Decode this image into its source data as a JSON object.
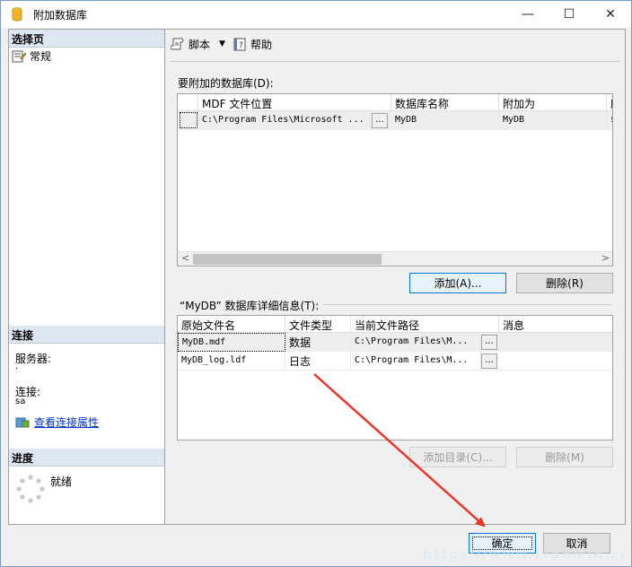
{
  "window": {
    "title": "附加数据库",
    "minimize": "—",
    "maximize": "☐",
    "close": "✕"
  },
  "left": {
    "select_page_header": "选择页",
    "pages": [
      {
        "label": "常规",
        "icon": "page-icon"
      }
    ],
    "connection_header": "连接",
    "server_label": "服务器:",
    "server_value": ".",
    "connection_label": "连接:",
    "connection_value": "sa",
    "view_properties_link": "查看连接属性",
    "progress_header": "进度",
    "progress_status": "就绪"
  },
  "toolbar": {
    "script_label": "脚本",
    "script_dropdown": "▼",
    "help_label": "帮助"
  },
  "attach_grid": {
    "label": "要附加的数据库(D):",
    "columns": [
      "MDF 文件位置",
      "数据库名称",
      "附加为",
      "所"
    ],
    "rows": [
      {
        "mdf": "C:\\Program Files\\Microsoft ...",
        "ellipsis": "...",
        "dbname": "MyDB",
        "attach_as": "MyDB",
        "owner": "s"
      }
    ],
    "scroll_left": "<",
    "scroll_right": ">"
  },
  "add_button": "添加(A)...",
  "remove_button": "删除(R)",
  "details": {
    "label": "“MyDB” 数据库详细信息(T):",
    "columns": [
      "原始文件名",
      "文件类型",
      "当前文件路径",
      "消息"
    ],
    "rows": [
      {
        "file": "MyDB.mdf",
        "type": "数据",
        "path": "C:\\Program Files\\M...",
        "ellipsis": "..."
      },
      {
        "file": "MyDB_log.ldf",
        "type": "日志",
        "path": "C:\\Program Files\\M...",
        "ellipsis": "..."
      }
    ]
  },
  "add_catalog_button": "添加目录(C)...",
  "remove_detail_button": "删除(M)",
  "ok_button": "确定",
  "cancel_button": "取消",
  "watermark": "https://www.i7admin.cc",
  "colors": {
    "section_header": "#dde7f2",
    "arrow": "#e8362a",
    "primary_border": "#0078d7"
  }
}
